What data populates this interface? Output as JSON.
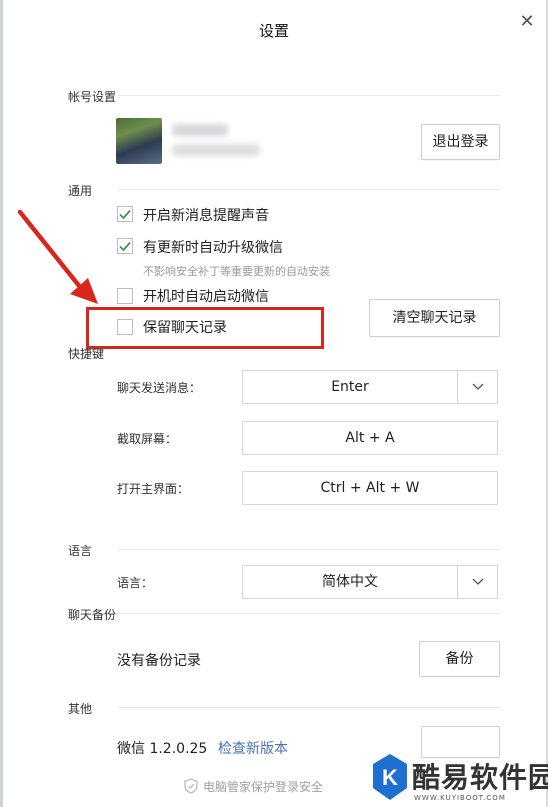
{
  "window": {
    "title": "设置",
    "close_glyph": "✕"
  },
  "account": {
    "section_label": "帐号设置",
    "logout_button": "退出登录"
  },
  "general": {
    "section_label": "通用",
    "options": [
      {
        "label": "开启新消息提醒声音",
        "checked": true
      },
      {
        "label": "有更新时自动升级微信",
        "checked": true,
        "hint": "不影响安全补丁等重要更新的自动安装"
      },
      {
        "label": "开机时自动启动微信",
        "checked": false
      },
      {
        "label": "保留聊天记录",
        "checked": false
      }
    ],
    "clear_button": "清空聊天记录"
  },
  "shortcuts": {
    "section_label": "快捷键",
    "items": [
      {
        "label": "聊天发送消息：",
        "value": "Enter",
        "dropdown": true
      },
      {
        "label": "截取屏幕：",
        "value": "Alt + A",
        "dropdown": false
      },
      {
        "label": "打开主界面：",
        "value": "Ctrl + Alt + W",
        "dropdown": false
      }
    ]
  },
  "language": {
    "section_label": "语言",
    "label": "语言：",
    "value": "简体中文"
  },
  "backup": {
    "section_label": "聊天备份",
    "status": "没有备份记录",
    "button": "备份"
  },
  "other": {
    "section_label": "其他",
    "version": "微信 1.2.0.25",
    "check_update_link": "检查新版本"
  },
  "footer": {
    "text": "电脑管家保护登录安全"
  },
  "watermark": {
    "text": "酷易软件园",
    "sub": "WWW.KUYIBOOT.COM",
    "logo_letter": "K"
  },
  "colors": {
    "checkmark": "#3a9c48",
    "link": "#4a72b8",
    "annotation": "#d9261c"
  }
}
